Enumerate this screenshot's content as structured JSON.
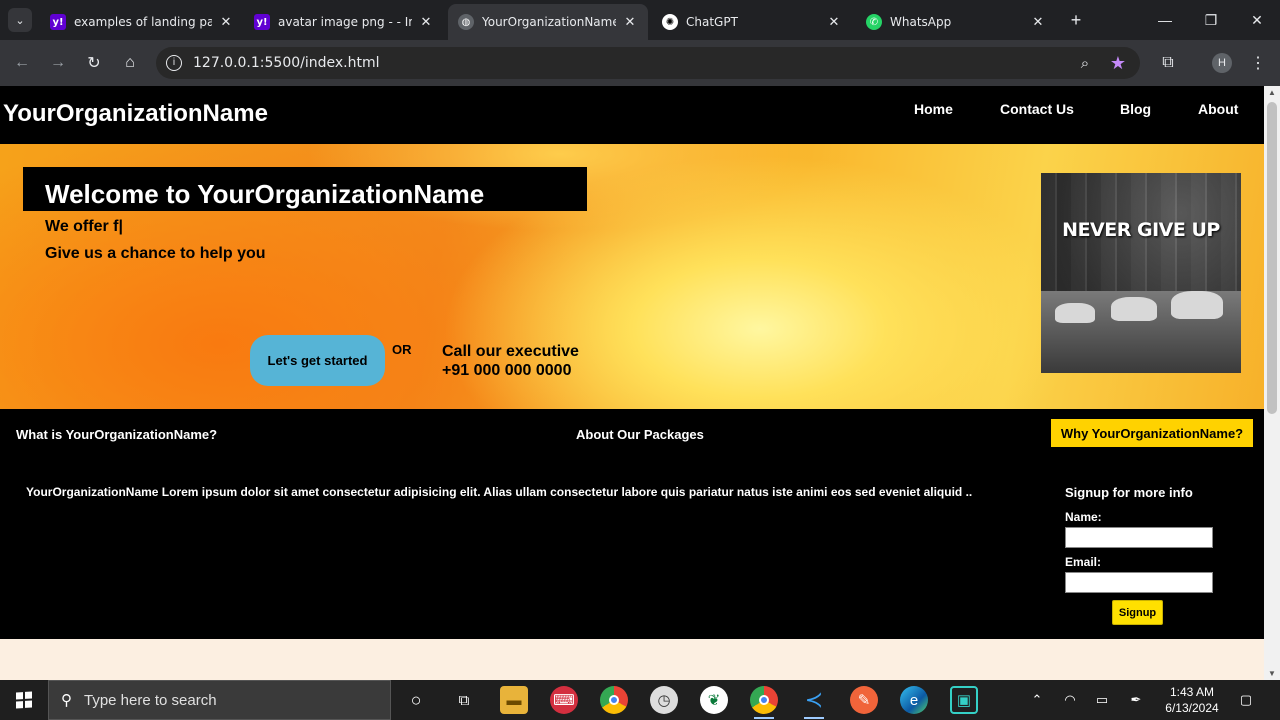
{
  "browser": {
    "tabs": [
      {
        "title": "examples of landing pag",
        "favicon": "yahoo-icon",
        "active": false
      },
      {
        "title": "avatar image png - - Ima",
        "favicon": "yahoo-icon",
        "active": false
      },
      {
        "title": "YourOrganizationName L",
        "favicon": "globe-icon",
        "active": true
      },
      {
        "title": "ChatGPT",
        "favicon": "chatgpt-icon",
        "active": false
      },
      {
        "title": "WhatsApp",
        "favicon": "whatsapp-icon",
        "active": false
      }
    ],
    "url": "127.0.0.1:5500/index.html",
    "profile_initial": "H",
    "accent_color": "#c58af9"
  },
  "site": {
    "brand": "YourOrganizationName",
    "nav": [
      {
        "label": "Home"
      },
      {
        "label": "Contact Us"
      },
      {
        "label": "Blog"
      },
      {
        "label": "About"
      }
    ],
    "hero": {
      "title": "Welcome to YourOrganizationName",
      "line1": "We offer f|",
      "line2": "Give us a chance to help you",
      "cta": "Let's get started",
      "or": "OR",
      "call_line1": "Call our executive",
      "call_line2": "+91 000 000 0000",
      "image_caption": "NEVER GIVE UP"
    },
    "info": {
      "col1_title": "What is YourOrganizationName?",
      "col2_title": "About Our Packages",
      "col3_button": "Why YourOrganizationName?",
      "text": "YourOrganizationName Lorem ipsum dolor sit amet consectetur adipisicing elit. Alias ullam consectetur labore quis pariatur natus iste animi eos sed eveniet aliquid ..",
      "signup": {
        "title": "Signup for more info",
        "name_label": "Name:",
        "name_value": "",
        "email_label": "Email:",
        "email_value": "",
        "button": "Signup"
      }
    },
    "colors": {
      "cta": "#56b4d6",
      "highlight": "#ffd200",
      "footer_bg": "#fcefe1"
    }
  },
  "taskbar": {
    "search_placeholder": "Type here to search",
    "time": "1:43 AM",
    "date": "6/13/2024"
  }
}
